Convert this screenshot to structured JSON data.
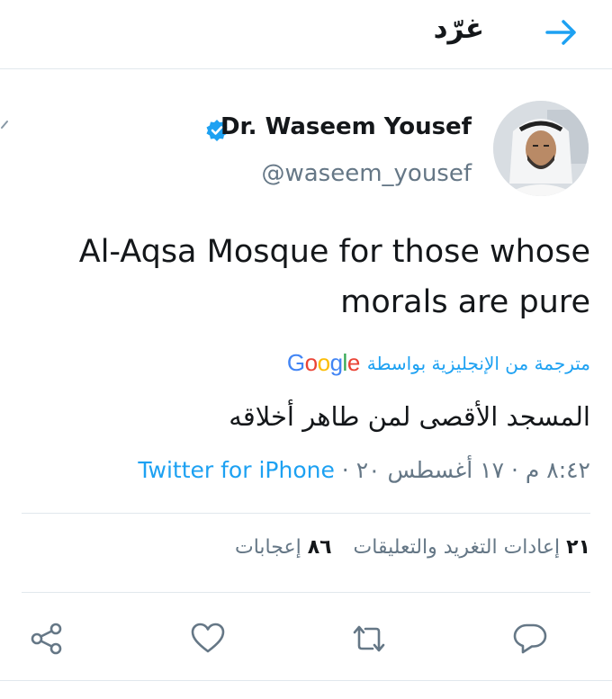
{
  "header": {
    "title": "غرّد",
    "back_icon": "arrow-right-icon"
  },
  "author": {
    "display_name": "Dr. Waseem Yousef",
    "handle": "@waseem_yousef",
    "verified_icon": "verified-badge-icon"
  },
  "tweet": {
    "text_line1": "Al-Aqsa Mosque for those whose",
    "text_line2": "morals are pure",
    "translated_by_label": "مترجمة من الإنجليزية بواسطة",
    "translated_text": "المسجد الأقصى لمن طاهر أخلاقه",
    "timestamp": "٨:٤٢ م · ١٧ أغسطس ٢٠ · ",
    "source": "Twitter for iPhone"
  },
  "stats": {
    "retweets_count": "٢١",
    "retweets_label": "إعادات التغريد والتعليقات",
    "likes_count": "٨٦",
    "likes_label": "إعجابات"
  },
  "actions": {
    "reply_icon": "reply-icon",
    "retweet_icon": "retweet-icon",
    "like_icon": "heart-icon",
    "share_icon": "share-icon"
  },
  "colors": {
    "accent": "#1da1f2",
    "secondary_text": "#657786",
    "divider": "#e1e8ed"
  }
}
